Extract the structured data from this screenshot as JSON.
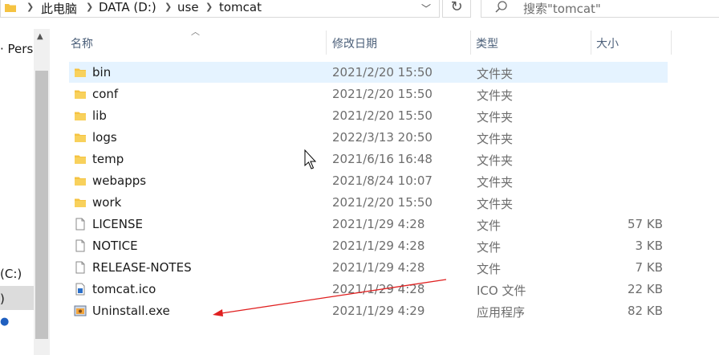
{
  "address": {
    "crumbs": [
      "此电脑",
      "DATA (D:)",
      "use",
      "tomcat"
    ]
  },
  "search": {
    "placeholder": "搜索\"tomcat\""
  },
  "nav": {
    "item_person": "· Perso",
    "item_c": "(C:)",
    "item_sel": ")"
  },
  "columns": {
    "name": "名称",
    "date": "修改日期",
    "type": "类型",
    "size": "大小"
  },
  "files": [
    {
      "name": "bin",
      "date": "2021/2/20 15:50",
      "type": "文件夹",
      "size": "",
      "icon": "folder-icon",
      "selected": true
    },
    {
      "name": "conf",
      "date": "2021/2/20 15:50",
      "type": "文件夹",
      "size": "",
      "icon": "folder-icon"
    },
    {
      "name": "lib",
      "date": "2021/2/20 15:50",
      "type": "文件夹",
      "size": "",
      "icon": "folder-icon"
    },
    {
      "name": "logs",
      "date": "2022/3/13 20:50",
      "type": "文件夹",
      "size": "",
      "icon": "folder-icon"
    },
    {
      "name": "temp",
      "date": "2021/6/16 16:48",
      "type": "文件夹",
      "size": "",
      "icon": "folder-icon"
    },
    {
      "name": "webapps",
      "date": "2021/8/24 10:07",
      "type": "文件夹",
      "size": "",
      "icon": "folder-icon"
    },
    {
      "name": "work",
      "date": "2021/2/20 15:50",
      "type": "文件夹",
      "size": "",
      "icon": "folder-icon"
    },
    {
      "name": "LICENSE",
      "date": "2021/1/29 4:28",
      "type": "文件",
      "size": "57 KB",
      "icon": "file-icon"
    },
    {
      "name": "NOTICE",
      "date": "2021/1/29 4:28",
      "type": "文件",
      "size": "3 KB",
      "icon": "file-icon"
    },
    {
      "name": "RELEASE-NOTES",
      "date": "2021/1/29 4:28",
      "type": "文件",
      "size": "7 KB",
      "icon": "file-icon"
    },
    {
      "name": "tomcat.ico",
      "date": "2021/1/29 4:28",
      "type": "ICO 文件",
      "size": "22 KB",
      "icon": "ico-file-icon"
    },
    {
      "name": "Uninstall.exe",
      "date": "2021/1/29 4:29",
      "type": "应用程序",
      "size": "82 KB",
      "icon": "exe-icon"
    }
  ],
  "colors": {
    "selection": "#e5f3ff",
    "folder": "#f5c342",
    "annotation_arrow": "#e02020",
    "header_text": "#4c607a"
  }
}
